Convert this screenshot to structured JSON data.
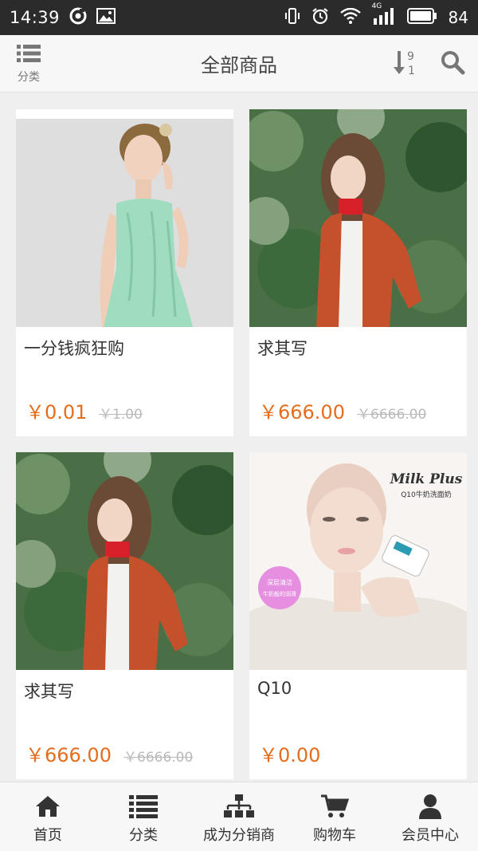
{
  "status_bar": {
    "time": "14:39",
    "network": "4G",
    "battery": "84"
  },
  "header": {
    "category_label": "分类",
    "title": "全部商品",
    "sort_icon": "sort-numeric-icon",
    "search_icon": "search-icon"
  },
  "products": [
    {
      "name": "一分钱疯狂购",
      "price": "￥0.01",
      "old_price": "￥1.00"
    },
    {
      "name": "求其写",
      "price": "￥666.00",
      "old_price": "￥6666.00"
    },
    {
      "name": "求其写",
      "price": "￥666.00",
      "old_price": "￥6666.00"
    },
    {
      "name": "Q10",
      "price": "￥0.00",
      "old_price": ""
    }
  ],
  "ad": {
    "brand": "Milk Plus",
    "tagline": "Q10牛奶洗面奶",
    "badge_line1": "深层清洁",
    "badge_line2": "牛奶般的润滑"
  },
  "bottom_nav": [
    {
      "label": "首页",
      "icon": "home-icon"
    },
    {
      "label": "分类",
      "icon": "list-icon"
    },
    {
      "label": "成为分销商",
      "icon": "sitemap-icon"
    },
    {
      "label": "购物车",
      "icon": "cart-icon"
    },
    {
      "label": "会员中心",
      "icon": "user-icon"
    }
  ],
  "colors": {
    "price": "#e46d1e",
    "status_bar": "#2b2b2b"
  }
}
